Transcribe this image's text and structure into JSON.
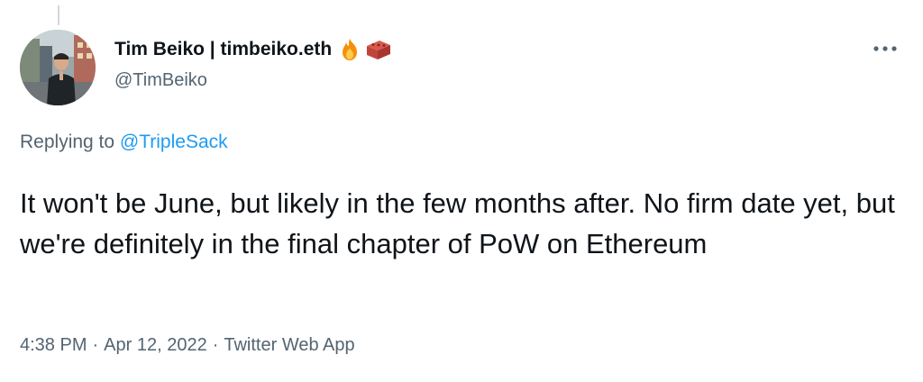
{
  "author": {
    "display_name": "Tim Beiko | timbeiko.eth",
    "name_emojis": [
      "fire-icon",
      "brick-icon"
    ],
    "handle": "@TimBeiko"
  },
  "reply": {
    "prefix": "Replying to ",
    "mention": "@TripleSack"
  },
  "tweet": {
    "text": "It won't be June, but likely in the few months after. No firm date yet, but we're definitely in the final chapter of PoW on Ethereum"
  },
  "meta": {
    "time": "4:38 PM",
    "separator": "·",
    "date": "Apr 12, 2022",
    "source": "Twitter Web App"
  },
  "colors": {
    "link": "#1d9bf0",
    "secondary_text": "#536471",
    "primary_text": "#0f1419"
  },
  "icons": {
    "more": "more-options-icon"
  }
}
